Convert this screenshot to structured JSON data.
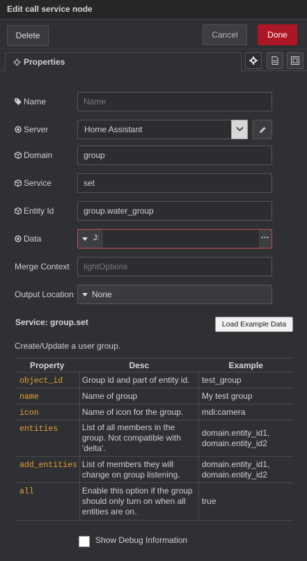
{
  "header": {
    "title": "Edit call service node"
  },
  "actions": {
    "delete": "Delete",
    "cancel": "Cancel",
    "done": "Done"
  },
  "tabs": {
    "properties": "Properties"
  },
  "form": {
    "name": {
      "label": "Name",
      "placeholder": "Name",
      "value": ""
    },
    "server": {
      "label": "Server",
      "value": "Home Assistant"
    },
    "domain": {
      "label": "Domain",
      "value": "group"
    },
    "service": {
      "label": "Service",
      "value": "set"
    },
    "entity_id": {
      "label": "Entity Id",
      "value": "group.water_group"
    },
    "data": {
      "label": "Data",
      "type": "J:",
      "more": "···"
    },
    "merge_context": {
      "label": "Merge Context",
      "placeholder": "lightOptions"
    },
    "output_location": {
      "label": "Output Location",
      "value": "None"
    }
  },
  "service_info": {
    "title": "Service: group.set",
    "load_button": "Load Example Data",
    "description": "Create/Update a user group.",
    "columns": [
      "Property",
      "Desc",
      "Example"
    ],
    "rows": [
      {
        "prop": "object_id",
        "desc": "Group id and part of entity id.",
        "example": "test_group"
      },
      {
        "prop": "name",
        "desc": "Name of group",
        "example": "My test group"
      },
      {
        "prop": "icon",
        "desc": "Name of icon for the group.",
        "example": "mdi:camera"
      },
      {
        "prop": "entities",
        "desc": "List of all members in the group. Not compatible with 'delta'.",
        "example": "domain.entity_id1, domain.entity_id2"
      },
      {
        "prop": "add_entities",
        "desc": "List of members they will change on group listening.",
        "example": "domain.entity_id1, domain.entity_id2"
      },
      {
        "prop": "all",
        "desc": "Enable this option if the group should only turn on when all entities are on.",
        "example": "true"
      }
    ]
  },
  "debug": {
    "label": "Show Debug Information",
    "checked": false
  },
  "colors": {
    "done": "#ad1625",
    "property": "#e5a032",
    "data_error_border": "#c44b52"
  }
}
